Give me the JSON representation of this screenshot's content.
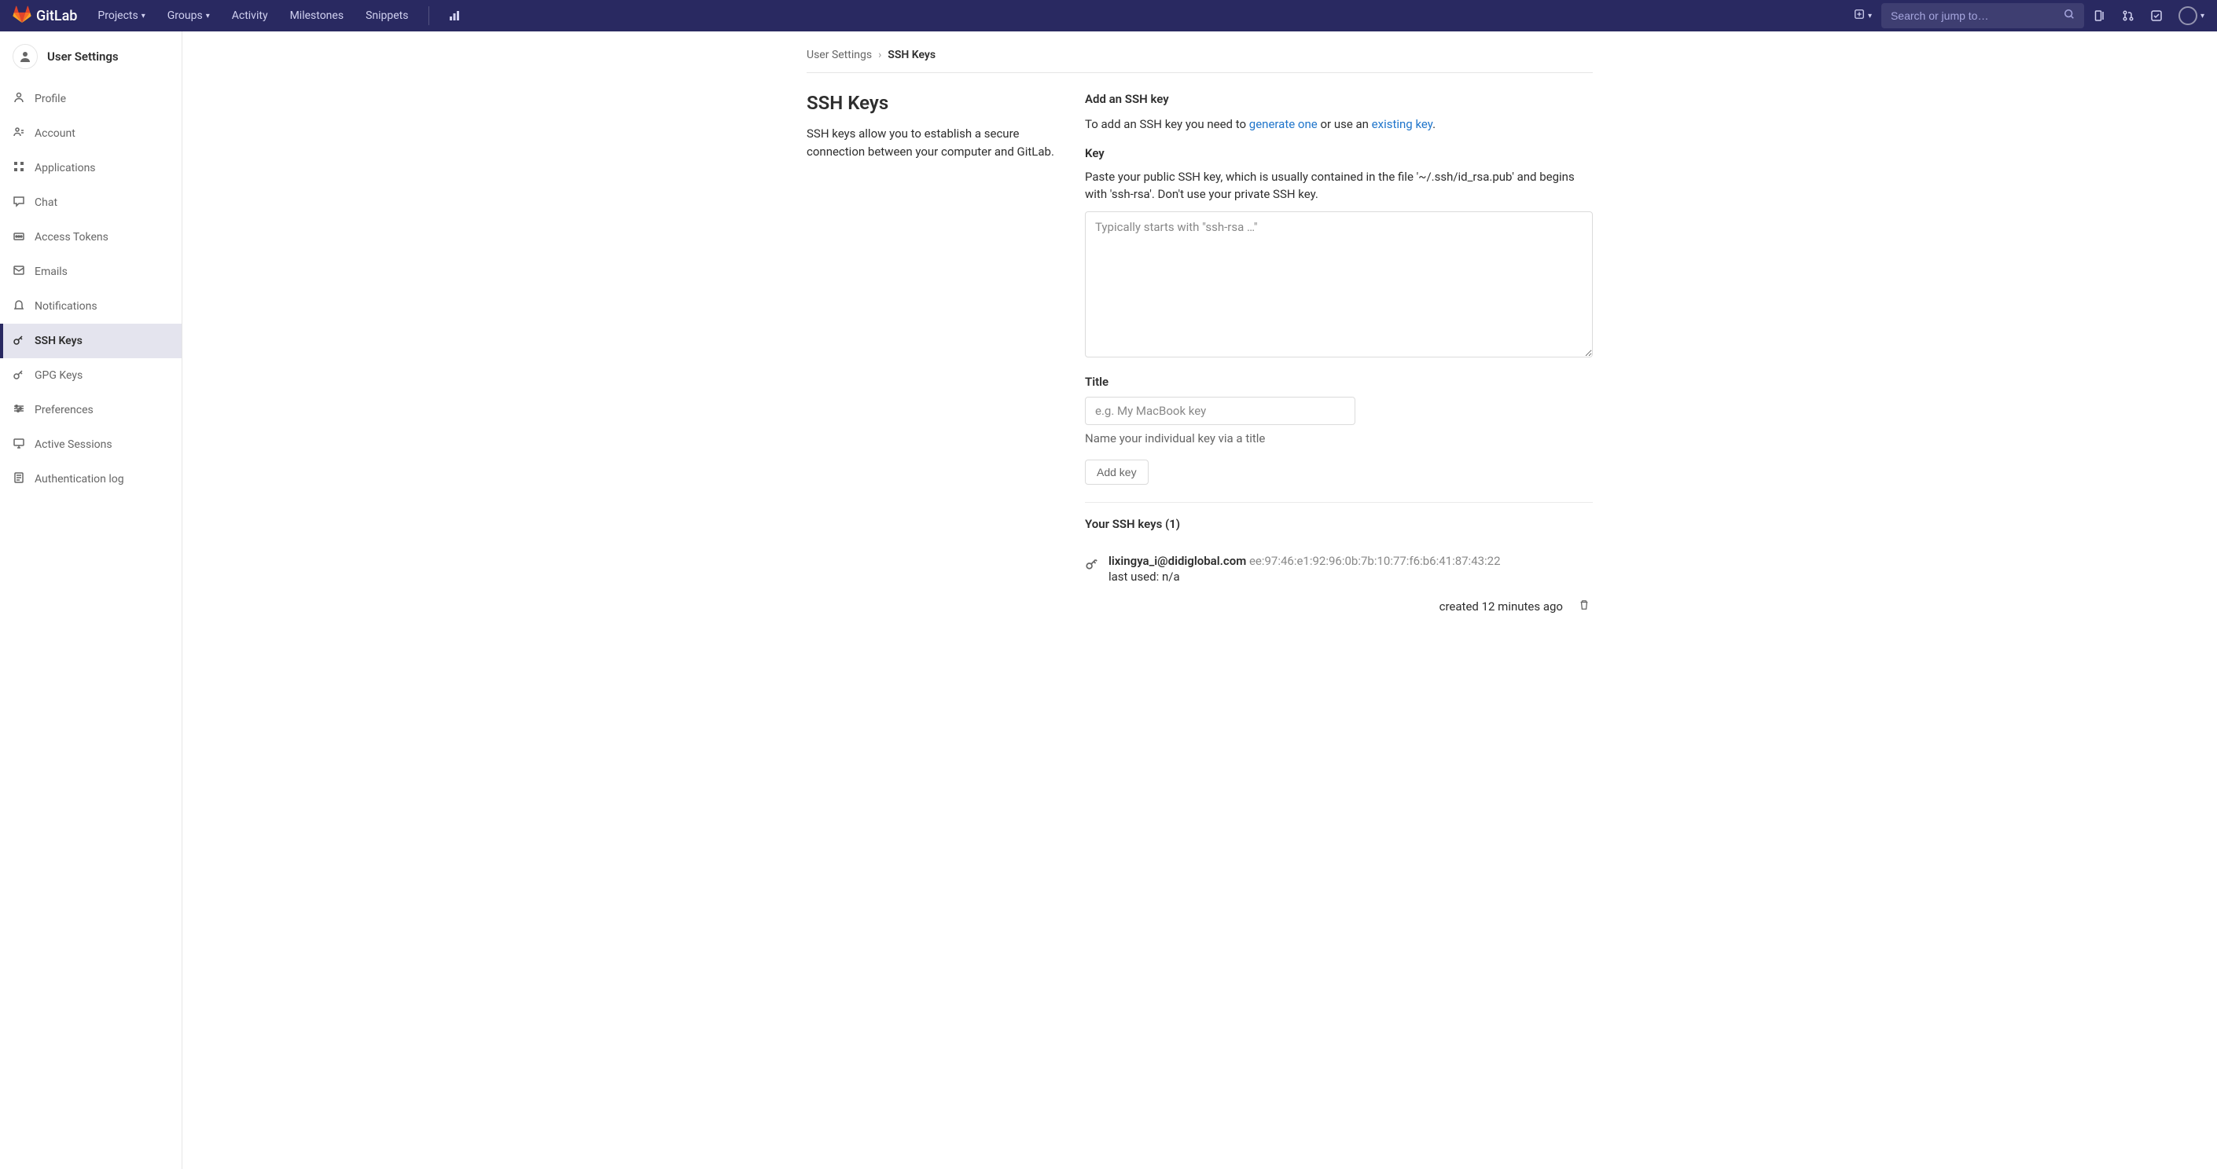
{
  "navbar": {
    "brand": "GitLab",
    "items": [
      {
        "label": "Projects",
        "dropdown": true
      },
      {
        "label": "Groups",
        "dropdown": true
      },
      {
        "label": "Activity",
        "dropdown": false
      },
      {
        "label": "Milestones",
        "dropdown": false
      },
      {
        "label": "Snippets",
        "dropdown": false
      }
    ],
    "search_placeholder": "Search or jump to…"
  },
  "sidebar": {
    "title": "User Settings",
    "items": [
      {
        "label": "Profile",
        "icon": "profile"
      },
      {
        "label": "Account",
        "icon": "account"
      },
      {
        "label": "Applications",
        "icon": "applications"
      },
      {
        "label": "Chat",
        "icon": "chat"
      },
      {
        "label": "Access Tokens",
        "icon": "tokens"
      },
      {
        "label": "Emails",
        "icon": "emails"
      },
      {
        "label": "Notifications",
        "icon": "notifications"
      },
      {
        "label": "SSH Keys",
        "icon": "key",
        "active": true
      },
      {
        "label": "GPG Keys",
        "icon": "key"
      },
      {
        "label": "Preferences",
        "icon": "preferences"
      },
      {
        "label": "Active Sessions",
        "icon": "sessions"
      },
      {
        "label": "Authentication log",
        "icon": "authlog"
      }
    ]
  },
  "breadcrumbs": [
    "User Settings",
    "SSH Keys"
  ],
  "section": {
    "title": "SSH Keys",
    "desc": "SSH keys allow you to establish a secure connection between your computer and GitLab."
  },
  "form": {
    "add_title": "Add an SSH key",
    "add_text_pre": "To add an SSH key you need to ",
    "add_link1": "generate one",
    "add_text_mid": " or use an ",
    "add_link2": "existing key",
    "add_text_post": ".",
    "key_label": "Key",
    "key_hint": "Paste your public SSH key, which is usually contained in the file '~/.ssh/id_rsa.pub' and begins with 'ssh-rsa'. Don't use your private SSH key.",
    "key_placeholder": "Typically starts with \"ssh-rsa …\"",
    "title_label": "Title",
    "title_placeholder": "e.g. My MacBook key",
    "title_help": "Name your individual key via a title",
    "add_button": "Add key"
  },
  "keys": {
    "heading": "Your SSH keys (1)",
    "list": [
      {
        "name": "lixingya_i@didiglobal.com",
        "fingerprint": "ee:97:46:e1:92:96:0b:7b:10:77:f6:b6:41:87:43:22",
        "last_used_label": "last used:",
        "last_used_value": "n/a",
        "created": "created 12 minutes ago"
      }
    ]
  }
}
